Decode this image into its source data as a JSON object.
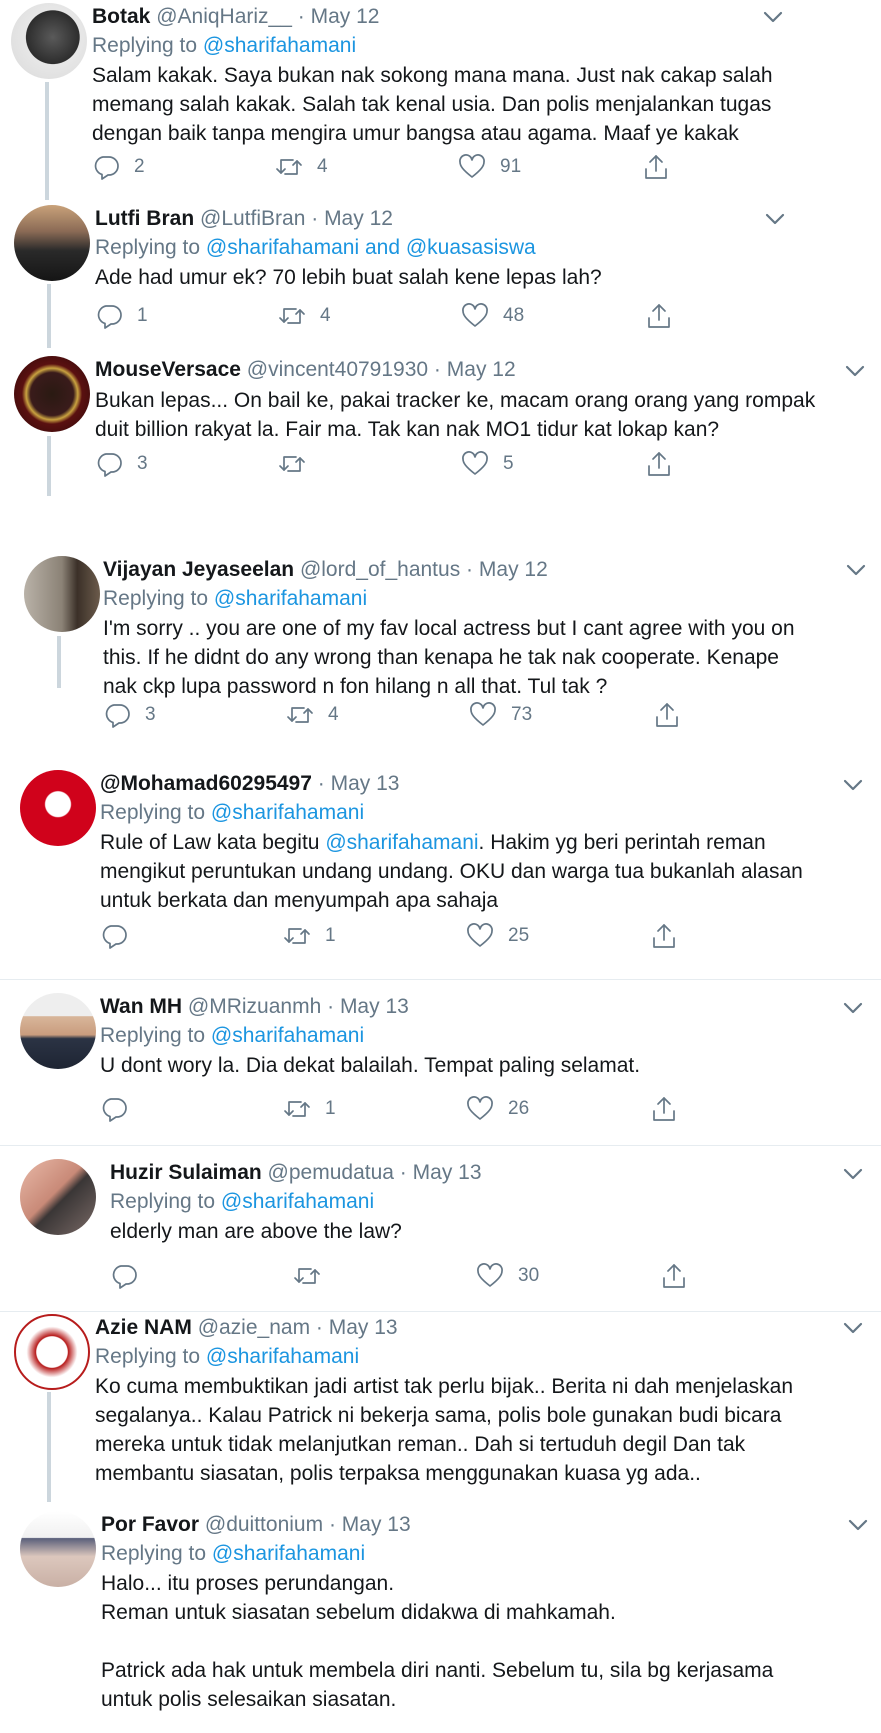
{
  "tweets": [
    {
      "name": "Botak",
      "handle": "@AniqHariz__",
      "date": "May 12",
      "replying_label": "Replying to",
      "replying_to": "@sharifahamani",
      "lines": [
        "Salam kakak. Saya bukan nak sokong mana mana. Just nak cakap salah",
        "memang salah kakak. Salah tak kenal usia. Dan polis menjalankan tugas",
        "dengan baik tanpa mengira umur bangsa atau agama. Maaf ye kakak"
      ],
      "replies": "2",
      "retweets": "4",
      "likes": "91"
    },
    {
      "name": "Lutfi Bran",
      "handle": "@LutfiBran",
      "date": "May 12",
      "replying_label": "Replying to",
      "replying_to": "@sharifahamani and @kuasasiswa",
      "lines": [
        "Ade had umur ek? 70 lebih buat salah kene lepas lah?"
      ],
      "replies": "1",
      "retweets": "4",
      "likes": "48"
    },
    {
      "name": "MouseVersace",
      "handle": "@vincent40791930",
      "date": "May 12",
      "lines": [
        "Bukan lepas... On bail ke, pakai tracker ke, macam orang orang yang rompak",
        "duit billion rakyat la. Fair ma. Tak kan nak MO1 tidur kat lokap kan?"
      ],
      "replies": "3",
      "retweets": "",
      "likes": "5"
    },
    {
      "name": "Vijayan Jeyaseelan",
      "handle": "@lord_of_hantus",
      "date": "May 12",
      "replying_label": "Replying to",
      "replying_to": "@sharifahamani",
      "lines": [
        "I'm sorry .. you are one of my fav local actress but I cant agree with you on",
        "this. If he didnt do any wrong than kenapa he tak nak cooperate.  Kenape",
        "nak ckp lupa password n fon hilang n all that. Tul tak ?"
      ],
      "replies": "3",
      "retweets": "4",
      "likes": "73"
    },
    {
      "name": "@Mohamad60295497",
      "handle": "",
      "date": "May 13",
      "replying_label": "Replying to",
      "replying_to": "@sharifahamani",
      "lines_rich": [
        {
          "pre": "Rule of Law kata begitu ",
          "mention": "@sharifahamani",
          "post": ". Hakim yg beri perintah reman"
        },
        {
          "pre": "mengikut peruntukan undang undang. OKU dan warga tua bukanlah alasan",
          "mention": "",
          "post": ""
        },
        {
          "pre": "untuk berkata dan menyumpah apa sahaja",
          "mention": "",
          "post": ""
        }
      ],
      "replies": "",
      "retweets": "1",
      "likes": "25"
    },
    {
      "name": "Wan MH",
      "handle": "@MRizuanmh",
      "date": "May 13",
      "replying_label": "Replying to",
      "replying_to": "@sharifahamani",
      "lines": [
        "U dont wory la. Dia dekat balailah. Tempat paling selamat."
      ],
      "replies": "",
      "retweets": "1",
      "likes": "26"
    },
    {
      "name": "Huzir Sulaiman",
      "handle": "@pemudatua",
      "date": "May 13",
      "replying_label": "Replying to",
      "replying_to": "@sharifahamani",
      "lines": [
        "elderly man are above the law?"
      ],
      "replies": "",
      "retweets": "",
      "likes": "30"
    },
    {
      "name": "Azie NAM",
      "handle": "@azie_nam",
      "date": "May 13",
      "replying_label": "Replying to",
      "replying_to": "@sharifahamani",
      "lines": [
        "Ko cuma membuktikan jadi artist tak perlu bijak.. Berita ni dah menjelaskan",
        "segalanya.. Kalau Patrick ni bekerja sama, polis bole gunakan budi bicara",
        "mereka untuk tidak melanjutkan reman.. Dah si tertuduh degil Dan tak",
        "membantu siasatan, polis terpaksa menggunakan kuasa yg ada.."
      ]
    },
    {
      "name": "Por Favor",
      "handle": "@duittonium",
      "date": "May 13",
      "replying_label": "Replying to",
      "replying_to": "@sharifahamani",
      "lines": [
        "Halo... itu proses perundangan.",
        "Reman untuk siasatan sebelum didakwa di mahkamah.",
        "",
        "Patrick ada hak untuk membela diri nanti. Sebelum tu, sila bg kerjasama",
        "untuk polis selesaikan siasatan."
      ]
    }
  ],
  "separator": "·",
  "icons": [
    "reply-icon",
    "retweet-icon",
    "like-icon",
    "share-icon",
    "chevron-down-icon"
  ],
  "colors": {
    "mention": "#1b95e0",
    "muted": "#657786",
    "thread": "#ccd6dd",
    "divider": "#e6ecf0"
  }
}
